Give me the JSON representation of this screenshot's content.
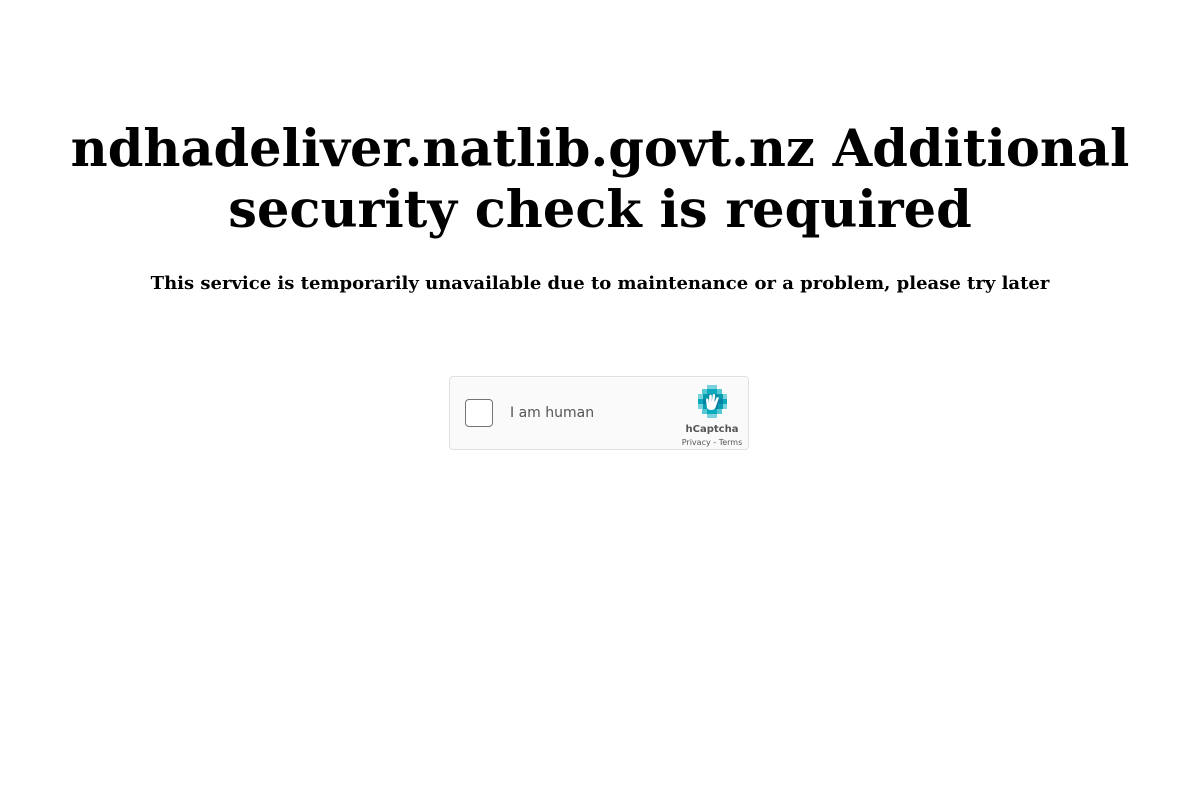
{
  "page": {
    "title": "ndhadeliver.natlib.govt.nz Additional security check is required",
    "message": "This service is temporarily unavailable due to maintenance or a problem, please try later"
  },
  "captcha": {
    "checkbox_label": "I am human",
    "checked": false,
    "brand_name": "hCaptcha",
    "brand_icon": "hcaptcha-logo-icon",
    "privacy_link": "Privacy",
    "separator": "-",
    "terms_link": "Terms"
  },
  "colors": {
    "background": "#ffffff",
    "text": "#000000",
    "captcha_background": "#fafafa",
    "captcha_border": "#e0e0e0",
    "brand_accent": "#00b5c5"
  }
}
